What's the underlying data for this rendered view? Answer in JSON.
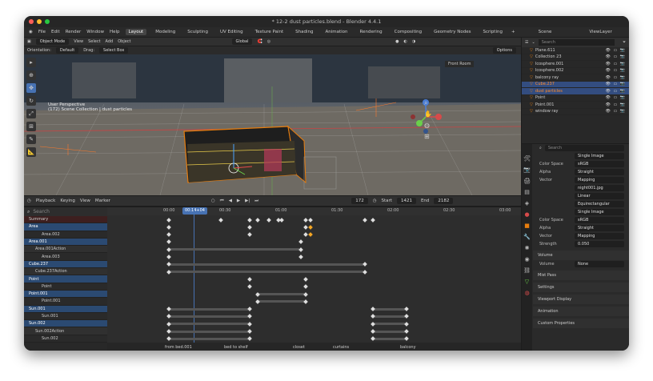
{
  "window": {
    "title": "* 12-2 dust particles.blend - Blender 4.4.1"
  },
  "menu": [
    "File",
    "Edit",
    "Render",
    "Window",
    "Help"
  ],
  "workspaces": [
    "Layout",
    "Modeling",
    "Sculpting",
    "UV Editing",
    "Texture Paint",
    "Shading",
    "Animation",
    "Rendering",
    "Compositing",
    "Geometry Nodes",
    "Scripting"
  ],
  "active_workspace": "Layout",
  "scene": "Scene",
  "view_layer": "ViewLayer",
  "viewport": {
    "mode": "Object Mode",
    "menus": [
      "View",
      "Select",
      "Add",
      "Object"
    ],
    "orientation_label": "Orientation:",
    "orientation": "Default",
    "drag_label": "Drag:",
    "drag": "Select Box",
    "transform": "Global",
    "options": "Options",
    "view_name": "User Perspective",
    "collection_info": "(172) Scene Collection | dust particles",
    "overlay_label": "Front Room"
  },
  "timeline": {
    "menus": [
      "Playback",
      "Keying",
      "View",
      "Marker"
    ],
    "current_frame": "172",
    "start_label": "Start",
    "start": "1421",
    "end_label": "End",
    "end": "2182",
    "search_placeholder": "Search",
    "playhead_time": "00:14+04",
    "ticks": [
      "00:00",
      "00:30",
      "01:00",
      "01:30",
      "02:00",
      "02:30",
      "03:00"
    ]
  },
  "channels": [
    {
      "label": "Summary",
      "kind": "summary"
    },
    {
      "label": "Area",
      "kind": "obj"
    },
    {
      "label": "Area.002",
      "kind": "ch"
    },
    {
      "label": "Area.001",
      "kind": "obj"
    },
    {
      "label": "Area.001Action",
      "kind": "act"
    },
    {
      "label": "Area.003",
      "kind": "ch"
    },
    {
      "label": "Cube.237",
      "kind": "obj"
    },
    {
      "label": "Cube.237Action",
      "kind": "act"
    },
    {
      "label": "Point",
      "kind": "obj"
    },
    {
      "label": "Point",
      "kind": "ch"
    },
    {
      "label": "Point.001",
      "kind": "obj"
    },
    {
      "label": "Point.001",
      "kind": "ch"
    },
    {
      "label": "Sun.001",
      "kind": "obj"
    },
    {
      "label": "Sun.001",
      "kind": "ch"
    },
    {
      "label": "Sun.002",
      "kind": "obj"
    },
    {
      "label": "Sun.002Action",
      "kind": "act"
    },
    {
      "label": "Sun.002",
      "kind": "ch"
    }
  ],
  "markers": [
    "from bed.001",
    "bed to shelf",
    "closet",
    "curtains",
    "balcony"
  ],
  "outliner": {
    "search_placeholder": "Search",
    "items": [
      {
        "name": "Plane.611",
        "selected": false
      },
      {
        "name": "Collection 23",
        "selected": false
      },
      {
        "name": "Icosphere.001",
        "selected": false
      },
      {
        "name": "Icosphere.002",
        "selected": false
      },
      {
        "name": "balcony ray",
        "selected": false
      },
      {
        "name": "Cube.237",
        "selected": true
      },
      {
        "name": "dust particles",
        "selected": true
      },
      {
        "name": "Point",
        "selected": false
      },
      {
        "name": "Point.001",
        "selected": false
      },
      {
        "name": "window ray",
        "selected": false
      }
    ]
  },
  "properties": {
    "search_placeholder": "Search",
    "image_type": "Single Image",
    "rows": [
      {
        "label": "Color Space",
        "value": "sRGB"
      },
      {
        "label": "Alpha",
        "value": "Straight"
      },
      {
        "label": "Vector",
        "value": "Mapping"
      },
      {
        "label": "",
        "value": "night001.jpg"
      },
      {
        "label": "",
        "value": "Linear"
      },
      {
        "label": "",
        "value": "Equirectangular"
      },
      {
        "label": "",
        "value": "Single Image"
      },
      {
        "label": "Color Space",
        "value": "sRGB"
      },
      {
        "label": "Alpha",
        "value": "Straight"
      },
      {
        "label": "Vector",
        "value": "Mapping"
      },
      {
        "label": "Strength",
        "value": "0.050"
      }
    ],
    "volume_panel": "Volume",
    "volume_label": "Volume",
    "volume_value": "None",
    "panels": [
      "Mist Pass",
      "Settings",
      "Viewport Display",
      "Animation",
      "Custom Properties"
    ]
  },
  "colors": {
    "accent": "#4772b3",
    "orange": "#e87d0d",
    "keyframe_selected": "#f5a623"
  }
}
